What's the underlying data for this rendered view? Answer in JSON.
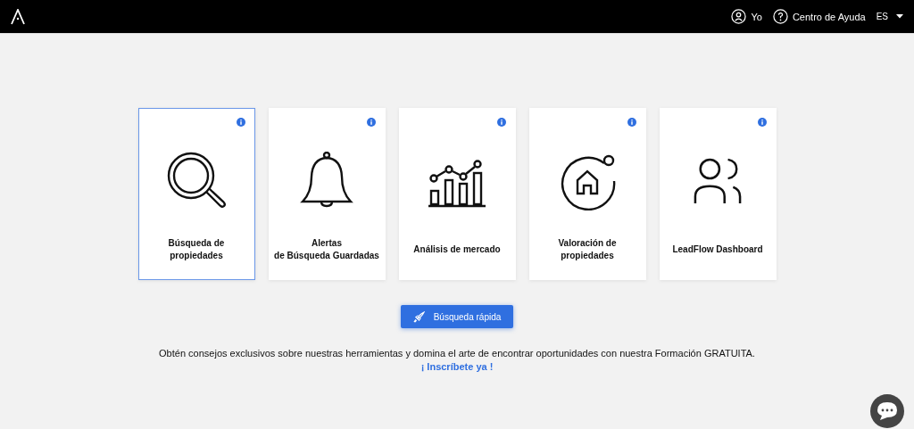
{
  "header": {
    "user": "Yo",
    "help": "Centro de Ayuda",
    "language": "ES"
  },
  "cards": [
    {
      "kind": "search",
      "label": "Búsqueda de\npropiedades",
      "selected": true
    },
    {
      "kind": "bell",
      "label": "Alertas\nde Búsqueda Guardadas",
      "selected": false
    },
    {
      "kind": "chart",
      "label": "Análisis de mercado",
      "selected": false
    },
    {
      "kind": "house",
      "label": "Valoración de\npropiedades",
      "selected": false
    },
    {
      "kind": "people",
      "label": "LeadFlow Dashboard",
      "selected": false
    }
  ],
  "quick_search": "Búsqueda rápida",
  "promo": "Obtén consejos exclusivos sobre nuestras herramientas y domina el arte de encontrar oportunidades con nuestra Formación GRATUITA.",
  "signup_link": "¡ Inscríbete ya !"
}
